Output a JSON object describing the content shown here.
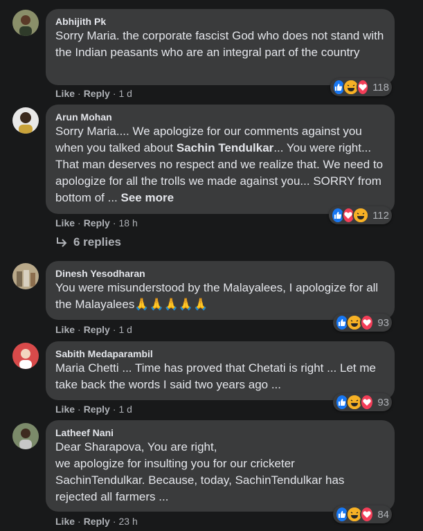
{
  "actions": {
    "like": "Like",
    "reply": "Reply"
  },
  "see_more": "See more",
  "replies_label": "6 replies",
  "comments": [
    {
      "author": "Abhijith Pk",
      "text_parts": [
        "Sorry Maria. the corporate fascist God who does not stand with the Indian peasants who are an integral part of the country"
      ],
      "time": "1 d",
      "reactions": [
        "like",
        "haha",
        "love"
      ],
      "count": "118"
    },
    {
      "author": "Arun Mohan",
      "text_a": "Sorry Maria.... We apologize for our comments against you when you talked about ",
      "text_b": "Sachin Tendulkar",
      "text_c": "... You were right... That man deserves no respect and we realize that. We need to apologize for all the trolls we made against you... SORRY from bottom of ... ",
      "time": "18 h",
      "reactions": [
        "like",
        "love",
        "haha"
      ],
      "count": "112"
    },
    {
      "author": "Dinesh Yesodharan",
      "text": "You were misunderstood by the Malayalees, I apologize for all the Malayalees🙏🙏🙏🙏🙏",
      "time": "1 d",
      "reactions": [
        "like",
        "haha",
        "love"
      ],
      "count": "93"
    },
    {
      "author": "Sabith Medaparambil",
      "text": "Maria Chetti ... Time has proved that Chetati is right ... Let me take back the words I said two years ago ...",
      "time": "1 d",
      "reactions": [
        "like",
        "haha",
        "love"
      ],
      "count": "93"
    },
    {
      "author": "Latheef Nani",
      "line1": "Dear Sharapova, You are right,",
      "line2": "we apologize for insulting you for our cricketer SachinTendulkar. Because, today, SachinTendulkar has rejected all farmers ...",
      "time": "23 h",
      "reactions": [
        "like",
        "haha",
        "love"
      ],
      "count": "84"
    }
  ],
  "colors": {
    "background": "#18191a",
    "bubble": "#3a3b3c",
    "like": "#1877f2",
    "love": "#f33e58",
    "haha": "#f7b125"
  }
}
